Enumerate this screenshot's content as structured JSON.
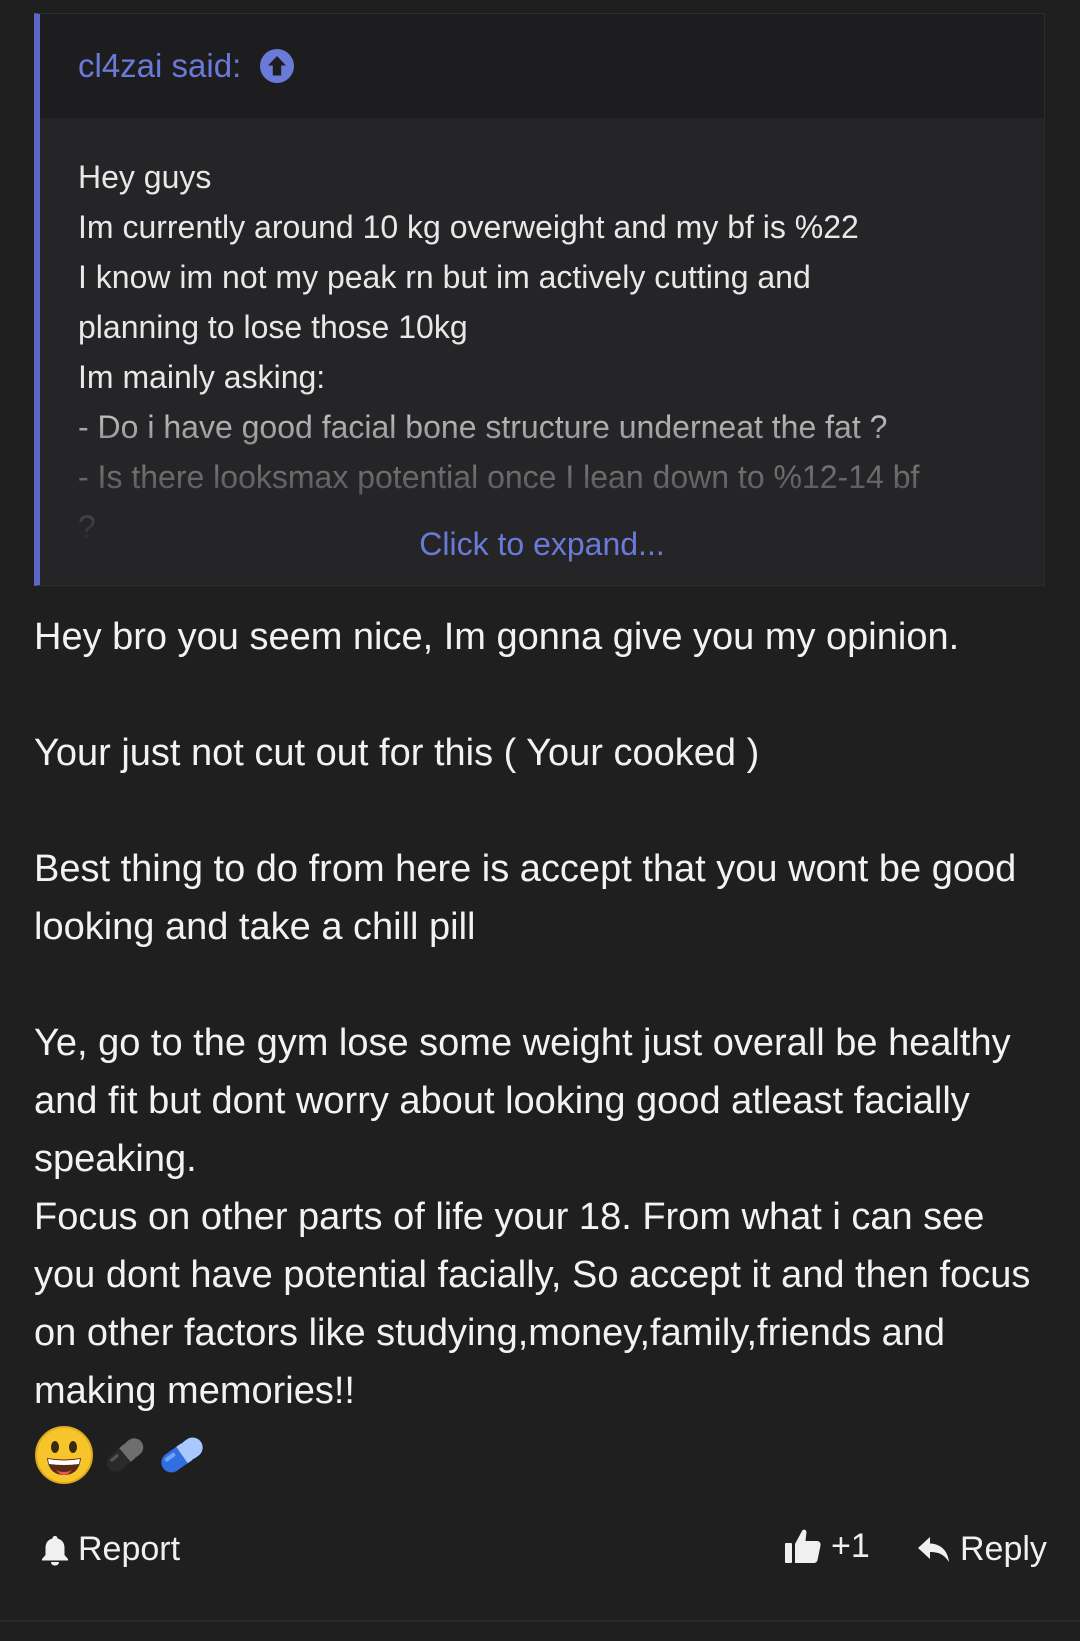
{
  "quote": {
    "author_label": "cl4zai said:",
    "lines": [
      "Hey guys",
      "Im currently around 10 kg overweight and my bf is %22",
      "I know im not my peak rn but im actively cutting and",
      "planning to lose those 10kg",
      "Im mainly asking:",
      "- Do i have good facial bone structure underneat the fat ?",
      "- Is there looksmax potential once I lean down to %12-14 bf",
      "?"
    ],
    "expand_label": "Click to expand..."
  },
  "message": {
    "paragraph1": "Hey bro you seem nice, Im gonna give you my opinion.",
    "paragraph2": "Your just not cut out for this ( Your cooked )",
    "paragraph3": "Best thing to do from here is accept that you wont be good looking and take a chill pill",
    "paragraph4_line1": "Ye, go to the gym lose some weight just overall be healthy and fit but dont worry about looking good atleast facially speaking.",
    "paragraph4_line2": "Focus on other parts of life your 18. From what i can see you dont have potential facially, So accept it and then focus on other factors like studying,money,family,friends and making memories!!",
    "emojis": [
      "grinning-face",
      "black-pill",
      "blue-pill"
    ]
  },
  "actions": {
    "report_label": "Report",
    "like_count": "+1",
    "reply_label": "Reply"
  },
  "colors": {
    "accent": "#6a7ad8",
    "quote_border": "#5b68c8",
    "background": "#1f1f20"
  }
}
